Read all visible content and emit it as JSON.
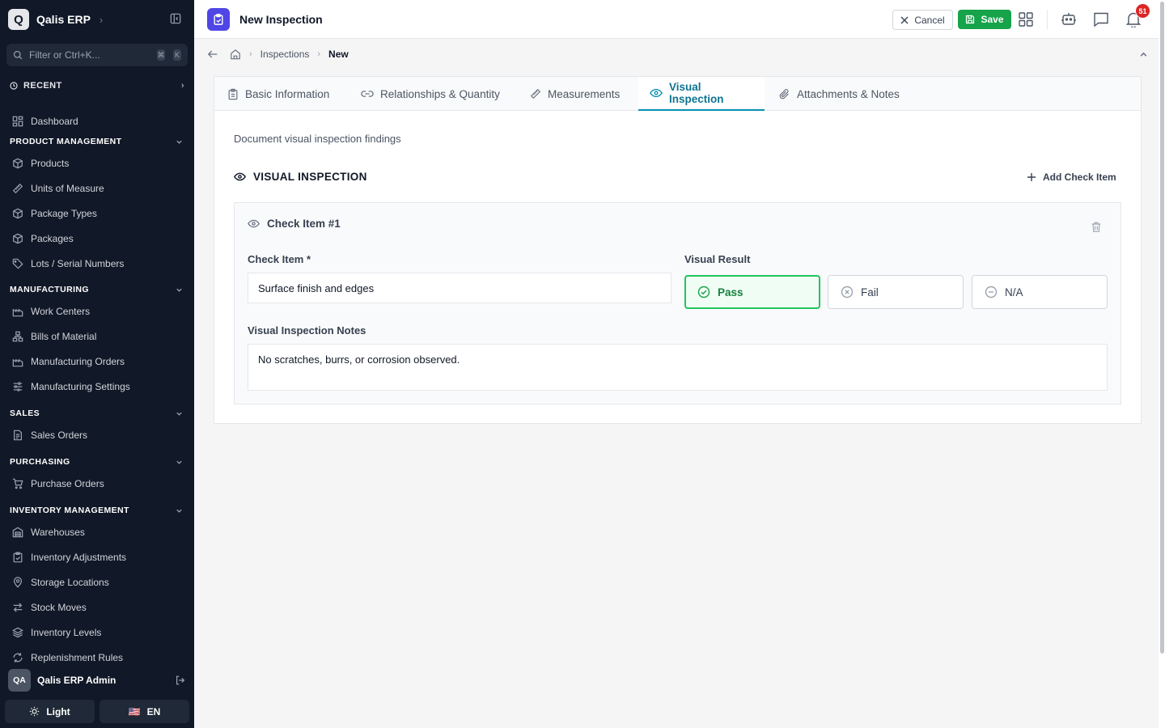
{
  "sidebar": {
    "brand": {
      "logo_letter": "Q",
      "name": "Qalis ERP"
    },
    "filter": {
      "placeholder": "Filter or Ctrl+K...",
      "kbd1": "⌘",
      "kbd2": "K"
    },
    "recent_label": "RECENT",
    "dashboard_label": "Dashboard",
    "sections": [
      {
        "title": "PRODUCT MANAGEMENT",
        "items": [
          "Products",
          "Units of Measure",
          "Package Types",
          "Packages",
          "Lots / Serial Numbers"
        ]
      },
      {
        "title": "MANUFACTURING",
        "items": [
          "Work Centers",
          "Bills of Material",
          "Manufacturing Orders",
          "Manufacturing Settings"
        ]
      },
      {
        "title": "SALES",
        "items": [
          "Sales Orders"
        ]
      },
      {
        "title": "PURCHASING",
        "items": [
          "Purchase Orders"
        ]
      },
      {
        "title": "INVENTORY MANAGEMENT",
        "items": [
          "Warehouses",
          "Inventory Adjustments",
          "Storage Locations",
          "Stock Moves",
          "Inventory Levels",
          "Replenishment Rules"
        ]
      }
    ],
    "user": {
      "initials": "QA",
      "name": "Qalis ERP Admin"
    },
    "theme_label": "Light",
    "lang_flag": "🇺🇸",
    "lang_label": "EN"
  },
  "header": {
    "title": "New Inspection",
    "cancel_label": "Cancel",
    "save_label": "Save",
    "notification_count": "51",
    "save_color": "#16a34a",
    "accent_color": "#4f46e5"
  },
  "breadcrumb": {
    "items": [
      "Inspections",
      "New"
    ]
  },
  "tabs": [
    {
      "label": "Basic Information",
      "icon": "clipboard-icon"
    },
    {
      "label": "Relationships & Quantity",
      "icon": "link-icon"
    },
    {
      "label": "Measurements",
      "icon": "ruler-icon"
    },
    {
      "label": "Visual Inspection",
      "icon": "eye-icon",
      "active": true
    },
    {
      "label": "Attachments & Notes",
      "icon": "paperclip-icon"
    }
  ],
  "visual": {
    "description": "Document visual inspection findings",
    "section_title": "VISUAL INSPECTION",
    "add_label": "Add Check Item",
    "check": {
      "title": "Check Item #1",
      "item_label": "Check Item *",
      "item_value": "Surface finish and edges",
      "result_label": "Visual Result",
      "options": [
        "Pass",
        "Fail",
        "N/A"
      ],
      "selected": "Pass",
      "notes_label": "Visual Inspection Notes",
      "notes_value": "No scratches, burrs, or corrosion observed."
    }
  }
}
